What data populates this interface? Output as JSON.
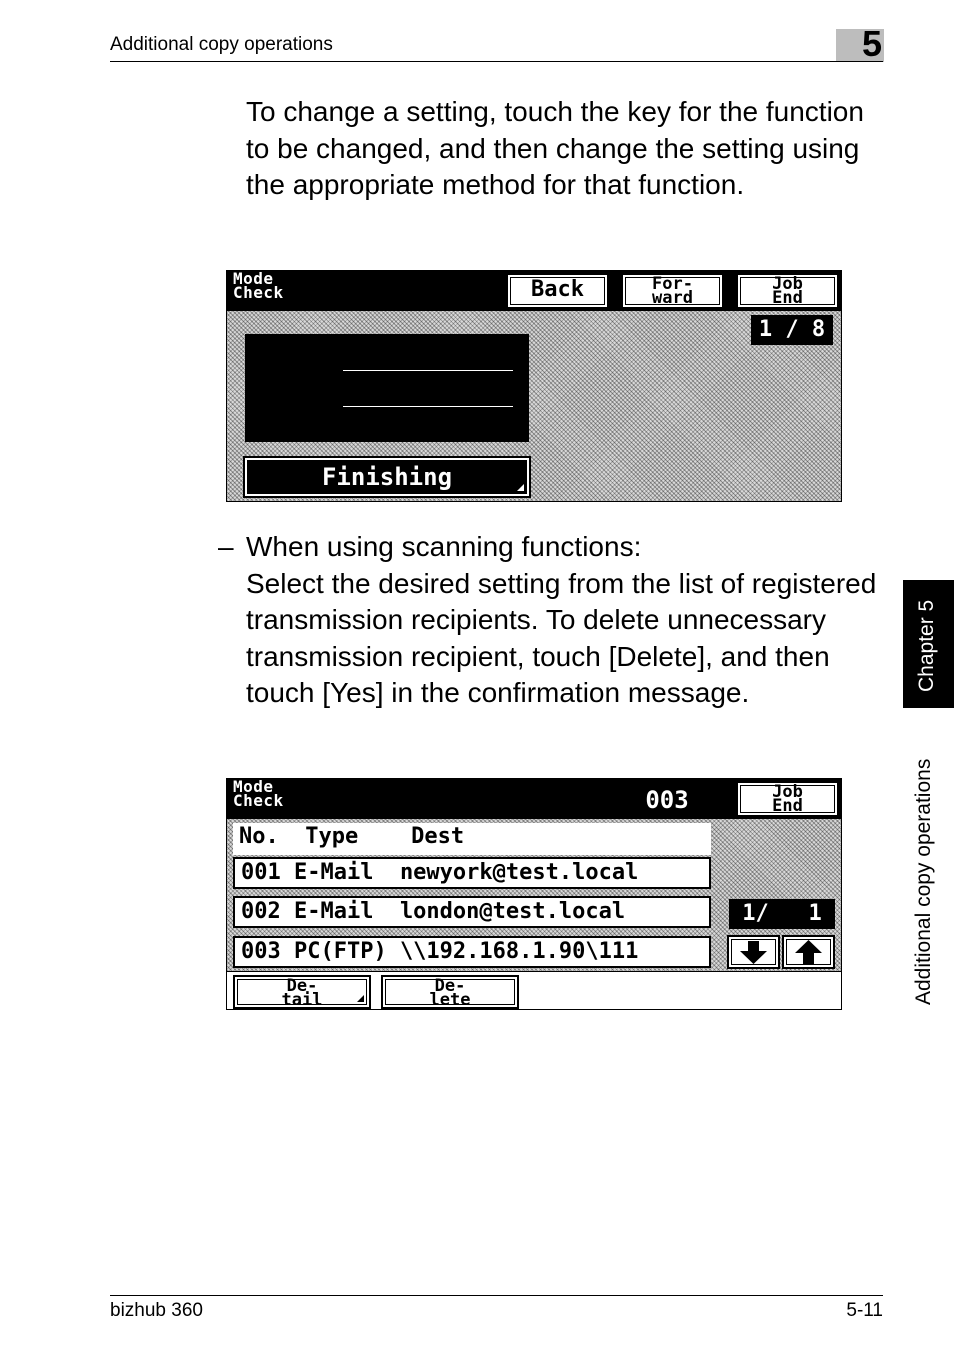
{
  "header": {
    "section_title": "Additional copy operations",
    "chapter_number": "5"
  },
  "body": {
    "paragraph1": "To change a setting, touch the key for the function to be changed, and then change the setting using the appropriate method for that function.",
    "bullet_dash": "–",
    "bullet_heading": "When using scanning functions:",
    "bullet_text": "Select the desired setting from the list of registered transmission recipients. To delete unnecessary transmission recipient, touch [Delete], and then touch [Yes] in the confirmation message."
  },
  "screen1": {
    "title_line1": "Mode",
    "title_line2": "Check",
    "back_label": "Back",
    "forward_line1": "For-",
    "forward_line2": "ward",
    "job_end_line1": "Job",
    "job_end_line2": "End",
    "page_counter": "1 / 8",
    "finishing_label": "Finishing"
  },
  "screen2": {
    "title_line1": "Mode",
    "title_line2": "Check",
    "count": "003",
    "job_end_line1": "Job",
    "job_end_line2": "End",
    "column_headers": "No.  Type    Dest",
    "rows": [
      "001 E-Mail  newyork@test.local",
      "002 E-Mail  london@test.local",
      "003 PC(FTP) \\\\192.168.1.90\\111"
    ],
    "page_counter": "1/   1",
    "detail_line1": "De-",
    "detail_line2": "tail",
    "delete_line1": "De-",
    "delete_line2": "lete"
  },
  "side_tab": {
    "chapter_label": "Chapter 5",
    "section_label": "Additional copy operations"
  },
  "footer": {
    "product": "bizhub 360",
    "page": "5-11"
  }
}
